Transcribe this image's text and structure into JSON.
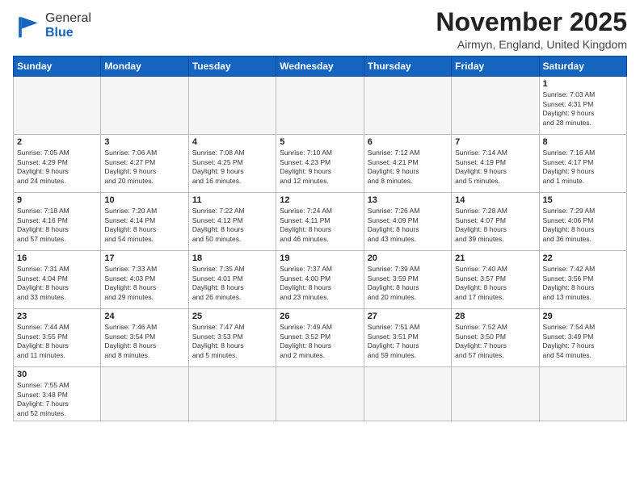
{
  "header": {
    "logo_general": "General",
    "logo_blue": "Blue",
    "month_title": "November 2025",
    "location": "Airmyn, England, United Kingdom"
  },
  "weekdays": [
    "Sunday",
    "Monday",
    "Tuesday",
    "Wednesday",
    "Thursday",
    "Friday",
    "Saturday"
  ],
  "weeks": [
    [
      {
        "day": "",
        "info": ""
      },
      {
        "day": "",
        "info": ""
      },
      {
        "day": "",
        "info": ""
      },
      {
        "day": "",
        "info": ""
      },
      {
        "day": "",
        "info": ""
      },
      {
        "day": "",
        "info": ""
      },
      {
        "day": "1",
        "info": "Sunrise: 7:03 AM\nSunset: 4:31 PM\nDaylight: 9 hours\nand 28 minutes."
      }
    ],
    [
      {
        "day": "2",
        "info": "Sunrise: 7:05 AM\nSunset: 4:29 PM\nDaylight: 9 hours\nand 24 minutes."
      },
      {
        "day": "3",
        "info": "Sunrise: 7:06 AM\nSunset: 4:27 PM\nDaylight: 9 hours\nand 20 minutes."
      },
      {
        "day": "4",
        "info": "Sunrise: 7:08 AM\nSunset: 4:25 PM\nDaylight: 9 hours\nand 16 minutes."
      },
      {
        "day": "5",
        "info": "Sunrise: 7:10 AM\nSunset: 4:23 PM\nDaylight: 9 hours\nand 12 minutes."
      },
      {
        "day": "6",
        "info": "Sunrise: 7:12 AM\nSunset: 4:21 PM\nDaylight: 9 hours\nand 8 minutes."
      },
      {
        "day": "7",
        "info": "Sunrise: 7:14 AM\nSunset: 4:19 PM\nDaylight: 9 hours\nand 5 minutes."
      },
      {
        "day": "8",
        "info": "Sunrise: 7:16 AM\nSunset: 4:17 PM\nDaylight: 9 hours\nand 1 minute."
      }
    ],
    [
      {
        "day": "9",
        "info": "Sunrise: 7:18 AM\nSunset: 4:16 PM\nDaylight: 8 hours\nand 57 minutes."
      },
      {
        "day": "10",
        "info": "Sunrise: 7:20 AM\nSunset: 4:14 PM\nDaylight: 8 hours\nand 54 minutes."
      },
      {
        "day": "11",
        "info": "Sunrise: 7:22 AM\nSunset: 4:12 PM\nDaylight: 8 hours\nand 50 minutes."
      },
      {
        "day": "12",
        "info": "Sunrise: 7:24 AM\nSunset: 4:11 PM\nDaylight: 8 hours\nand 46 minutes."
      },
      {
        "day": "13",
        "info": "Sunrise: 7:26 AM\nSunset: 4:09 PM\nDaylight: 8 hours\nand 43 minutes."
      },
      {
        "day": "14",
        "info": "Sunrise: 7:28 AM\nSunset: 4:07 PM\nDaylight: 8 hours\nand 39 minutes."
      },
      {
        "day": "15",
        "info": "Sunrise: 7:29 AM\nSunset: 4:06 PM\nDaylight: 8 hours\nand 36 minutes."
      }
    ],
    [
      {
        "day": "16",
        "info": "Sunrise: 7:31 AM\nSunset: 4:04 PM\nDaylight: 8 hours\nand 33 minutes."
      },
      {
        "day": "17",
        "info": "Sunrise: 7:33 AM\nSunset: 4:03 PM\nDaylight: 8 hours\nand 29 minutes."
      },
      {
        "day": "18",
        "info": "Sunrise: 7:35 AM\nSunset: 4:01 PM\nDaylight: 8 hours\nand 26 minutes."
      },
      {
        "day": "19",
        "info": "Sunrise: 7:37 AM\nSunset: 4:00 PM\nDaylight: 8 hours\nand 23 minutes."
      },
      {
        "day": "20",
        "info": "Sunrise: 7:39 AM\nSunset: 3:59 PM\nDaylight: 8 hours\nand 20 minutes."
      },
      {
        "day": "21",
        "info": "Sunrise: 7:40 AM\nSunset: 3:57 PM\nDaylight: 8 hours\nand 17 minutes."
      },
      {
        "day": "22",
        "info": "Sunrise: 7:42 AM\nSunset: 3:56 PM\nDaylight: 8 hours\nand 13 minutes."
      }
    ],
    [
      {
        "day": "23",
        "info": "Sunrise: 7:44 AM\nSunset: 3:55 PM\nDaylight: 8 hours\nand 11 minutes."
      },
      {
        "day": "24",
        "info": "Sunrise: 7:46 AM\nSunset: 3:54 PM\nDaylight: 8 hours\nand 8 minutes."
      },
      {
        "day": "25",
        "info": "Sunrise: 7:47 AM\nSunset: 3:53 PM\nDaylight: 8 hours\nand 5 minutes."
      },
      {
        "day": "26",
        "info": "Sunrise: 7:49 AM\nSunset: 3:52 PM\nDaylight: 8 hours\nand 2 minutes."
      },
      {
        "day": "27",
        "info": "Sunrise: 7:51 AM\nSunset: 3:51 PM\nDaylight: 7 hours\nand 59 minutes."
      },
      {
        "day": "28",
        "info": "Sunrise: 7:52 AM\nSunset: 3:50 PM\nDaylight: 7 hours\nand 57 minutes."
      },
      {
        "day": "29",
        "info": "Sunrise: 7:54 AM\nSunset: 3:49 PM\nDaylight: 7 hours\nand 54 minutes."
      }
    ],
    [
      {
        "day": "30",
        "info": "Sunrise: 7:55 AM\nSunset: 3:48 PM\nDaylight: 7 hours\nand 52 minutes."
      },
      {
        "day": "",
        "info": ""
      },
      {
        "day": "",
        "info": ""
      },
      {
        "day": "",
        "info": ""
      },
      {
        "day": "",
        "info": ""
      },
      {
        "day": "",
        "info": ""
      },
      {
        "day": "",
        "info": ""
      }
    ]
  ]
}
